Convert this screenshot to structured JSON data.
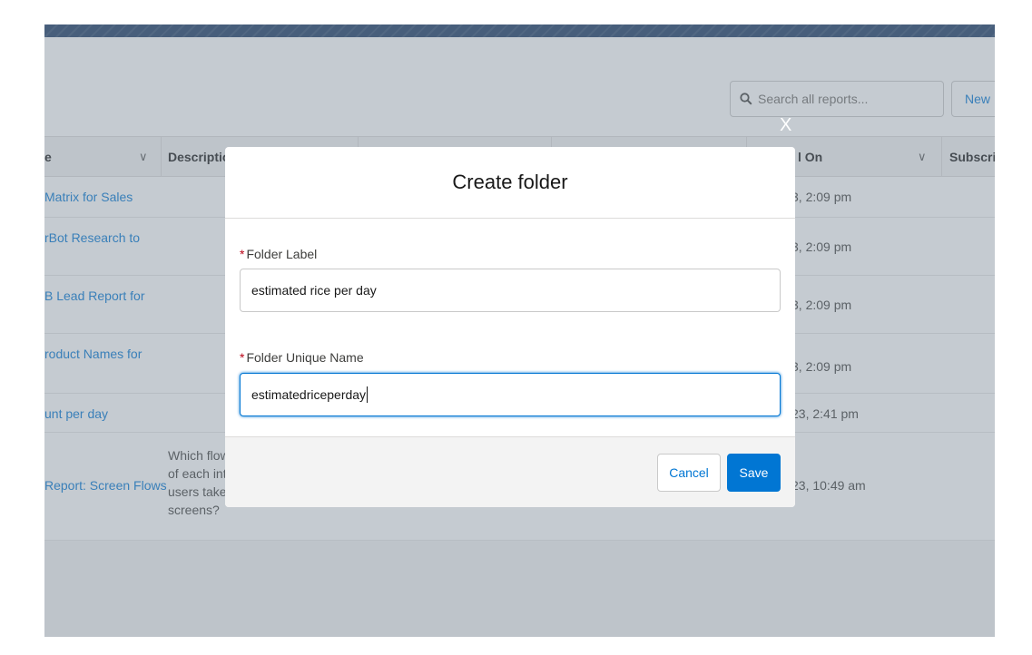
{
  "search": {
    "placeholder": "Search all reports..."
  },
  "header": {
    "new_button_label": "New R"
  },
  "table": {
    "columns": [
      {
        "label": "e"
      },
      {
        "label": "Descriptio"
      },
      {
        "label": ""
      },
      {
        "label": ""
      },
      {
        "label": "l On"
      },
      {
        "label": "Subscrib"
      }
    ],
    "rows": [
      {
        "name": "Matrix for Sales",
        "description": "",
        "date": "3, 2:09 pm"
      },
      {
        "name": "rBot Research to",
        "description": "",
        "date": "3, 2:09 pm"
      },
      {
        "name": "B Lead Report for",
        "description": "",
        "date": "3, 2:09 pm"
      },
      {
        "name": "roduct Names for",
        "description": "",
        "date": "3, 2:09 pm"
      },
      {
        "name": "unt per day",
        "description": "",
        "date": "23, 2:41 pm"
      },
      {
        "name": "Report: Screen Flows",
        "description_lines": [
          "Which flow",
          "of each int",
          "users take t",
          "screens?"
        ],
        "date": "23, 10:49 am"
      }
    ]
  },
  "modal": {
    "close_glyph": "X",
    "title": "Create folder",
    "required_marker": "*",
    "folder_label": {
      "label": "Folder Label",
      "value": "estimated rice per day"
    },
    "folder_unique_name": {
      "label": "Folder Unique Name",
      "value": "estimatedriceperday"
    },
    "cancel_label": "Cancel",
    "save_label": "Save"
  },
  "colors": {
    "brand": "#0176d3",
    "required": "#ba0517",
    "banner": "#1b3a63"
  }
}
